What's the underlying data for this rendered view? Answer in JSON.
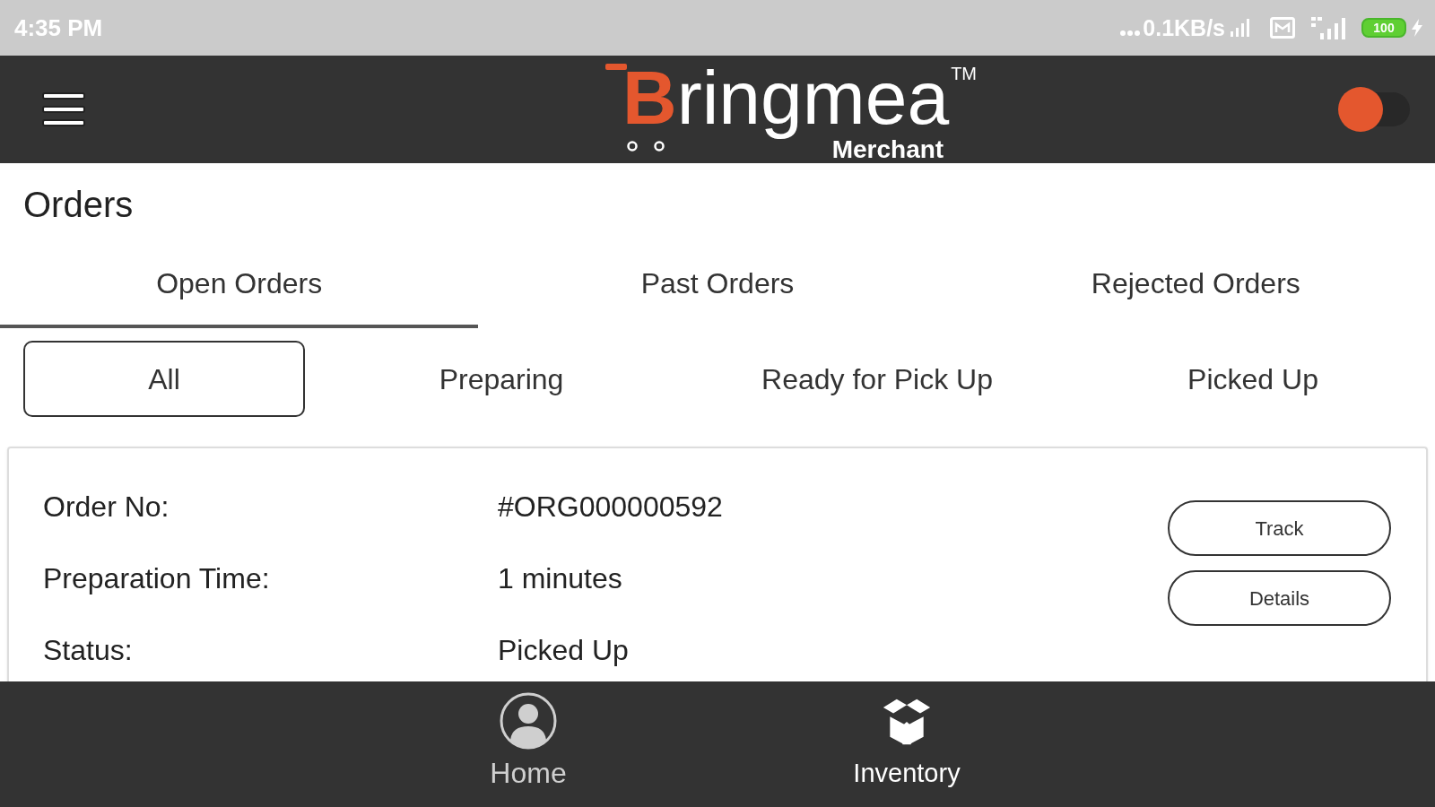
{
  "status_bar": {
    "time": "4:35 PM",
    "network_speed": "0.1KB/s",
    "battery": "100"
  },
  "header": {
    "logo": {
      "name": "Bringmea",
      "trademark": "TM",
      "subtitle": "Merchant"
    },
    "toggle": {
      "on": false
    }
  },
  "page_title": "Orders",
  "tabs": [
    {
      "label": "Open Orders",
      "selected": true
    },
    {
      "label": "Past Orders",
      "selected": false
    },
    {
      "label": "Rejected Orders",
      "selected": false
    }
  ],
  "filters": [
    {
      "label": "All",
      "selected": true
    },
    {
      "label": "Preparing",
      "selected": false
    },
    {
      "label": "Ready for Pick Up",
      "selected": false
    },
    {
      "label": "Picked Up",
      "selected": false
    }
  ],
  "orders": [
    {
      "fields": [
        {
          "label": "Order No:",
          "value": "#ORG000000592"
        },
        {
          "label": "Preparation Time:",
          "value": "1 minutes"
        },
        {
          "label": "Status:",
          "value": "Picked Up"
        }
      ],
      "actions": [
        "Track",
        "Details"
      ]
    }
  ],
  "bottom_nav": [
    {
      "label": "Home",
      "selected": false
    },
    {
      "label": "Inventory",
      "selected": true
    }
  ]
}
